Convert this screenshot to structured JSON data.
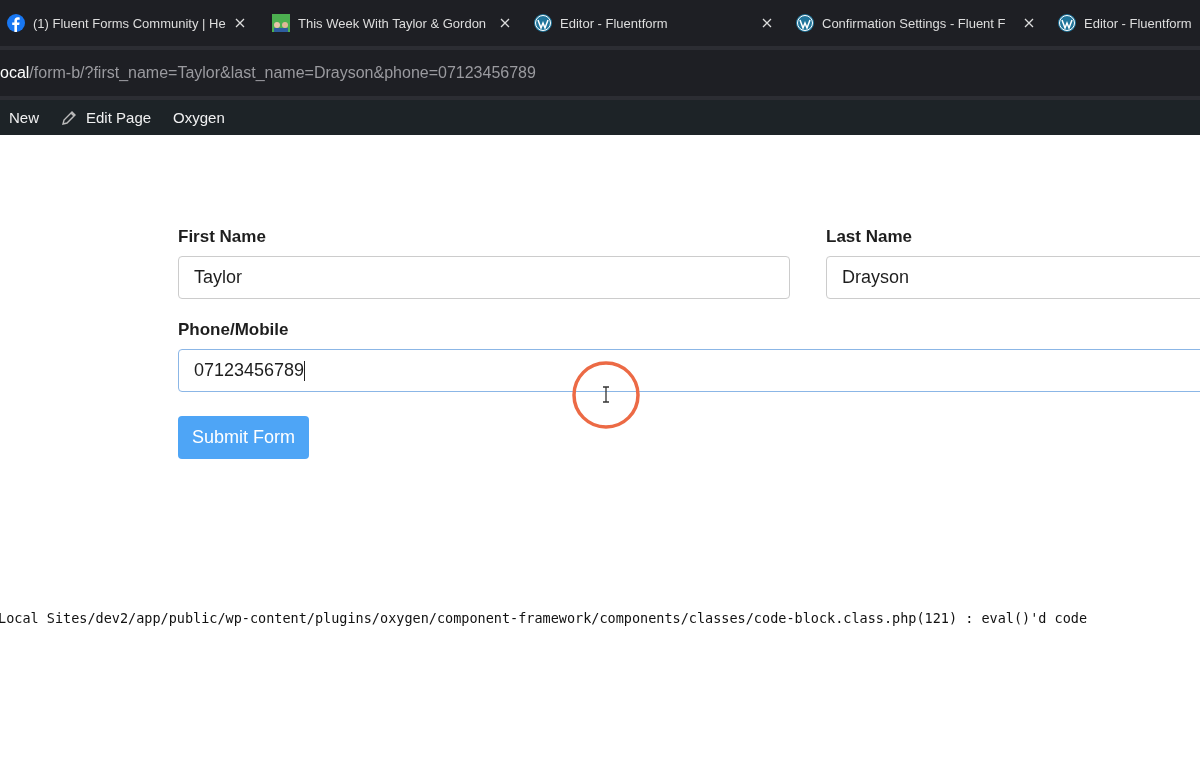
{
  "browser": {
    "tabs": [
      {
        "title": "(1) Fluent Forms Community | He",
        "kind": "facebook"
      },
      {
        "title": "This Week With Taylor & Gordon",
        "kind": "thumbnail"
      },
      {
        "title": "Editor - Fluentform",
        "kind": "wordpress"
      },
      {
        "title": "Confirmation Settings - Fluent F",
        "kind": "wordpress"
      },
      {
        "title": "Editor - Fluentform",
        "kind": "wordpress"
      }
    ],
    "address": {
      "host": "ocal",
      "path": "/form-b/?first_name=Taylor&last_name=Drayson&phone=07123456789"
    }
  },
  "admin_bar": {
    "items": [
      {
        "label": "New",
        "kind": "plain"
      },
      {
        "label": "Edit Page",
        "kind": "pencil"
      },
      {
        "label": "Oxygen",
        "kind": "plain"
      }
    ]
  },
  "form": {
    "rows": [
      [
        {
          "label": "First Name",
          "value": "Taylor",
          "focused": false
        },
        {
          "label": "Last Name",
          "value": "Drayson",
          "focused": false
        }
      ],
      [
        {
          "label": "Phone/Mobile",
          "value": "07123456789",
          "focused": true
        }
      ]
    ],
    "submit": "Submit Form"
  },
  "error_line": "Local Sites/dev2/app/public/wp-content/plugins/oxygen/component-framework/components/classes/code-block.class.php(121) : eval()'d code"
}
